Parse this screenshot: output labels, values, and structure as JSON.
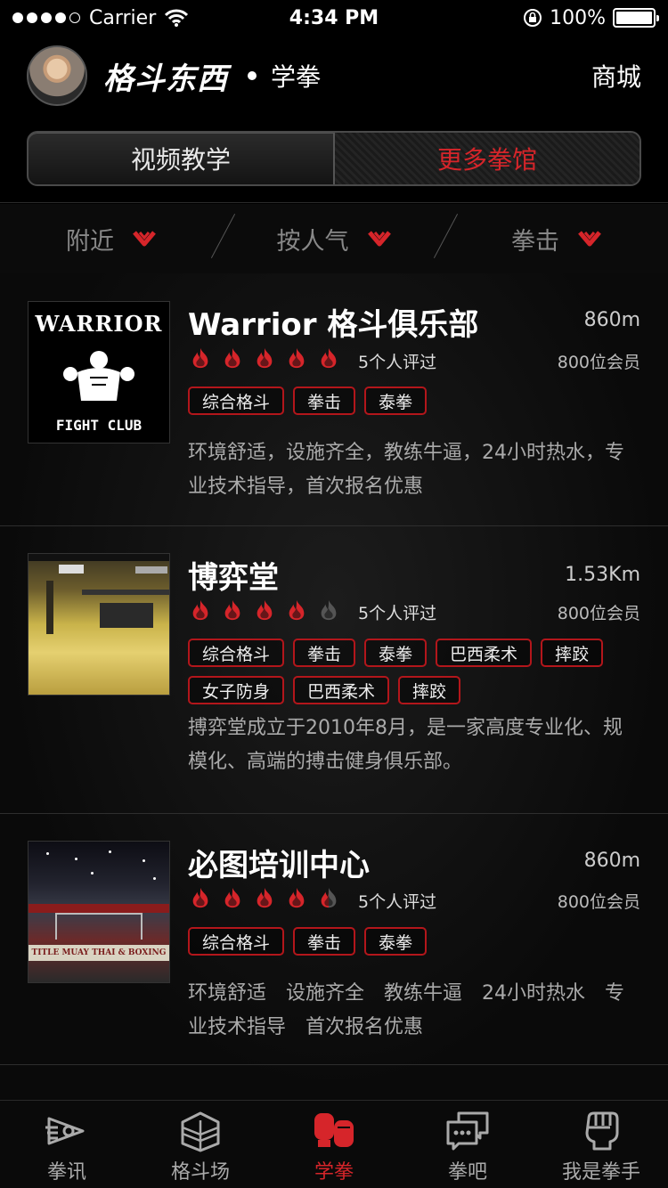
{
  "status": {
    "carrier": "Carrier",
    "time": "4:34 PM",
    "battery": "100%",
    "battery_level": 1.0
  },
  "header": {
    "logo": "格斗东西",
    "section": "学拳",
    "shop": "商城"
  },
  "segments": [
    {
      "label": "视频教学",
      "active": false
    },
    {
      "label": "更多拳馆",
      "active": true
    }
  ],
  "filters": [
    {
      "label": "附近"
    },
    {
      "label": "按人气"
    },
    {
      "label": "拳击"
    }
  ],
  "accent_color": "#d6252a",
  "gyms": [
    {
      "name": "Warrior 格斗俱乐部",
      "image": {
        "title": "WARRIOR",
        "subtitle": "FIGHT CLUB"
      },
      "distance": "860m",
      "rating": 5,
      "reviews": "5个人评过",
      "members": "800位会员",
      "tags": [
        "综合格斗",
        "拳击",
        "泰拳"
      ],
      "desc": "环境舒适，设施齐全，教练牛逼，24小时热水，专业技术指导，首次报名优惠"
    },
    {
      "name": "博弈堂",
      "image": {},
      "distance": "1.53Km",
      "rating": 4,
      "reviews": "5个人评过",
      "members": "800位会员",
      "tags": [
        "综合格斗",
        "拳击",
        "泰拳",
        "巴西柔术",
        "摔跤",
        "女子防身",
        "巴西柔术",
        "摔跤"
      ],
      "desc": "搏弈堂成立于2010年8月，是一家高度专业化、规模化、高端的搏击健身俱乐部。"
    },
    {
      "name": "必图培训中心",
      "image": {
        "banner": "TITLE MUAY THAI & BOXING"
      },
      "distance": "860m",
      "rating": 4.5,
      "reviews": "5个人评过",
      "members": "800位会员",
      "tags": [
        "综合格斗",
        "拳击",
        "泰拳"
      ],
      "desc": "环境舒适　设施齐全　教练牛逼　24小时热水　专业技术指导　首次报名优惠"
    }
  ],
  "tabs": [
    {
      "label": "拳讯",
      "icon": "news-icon",
      "active": false
    },
    {
      "label": "格斗场",
      "icon": "ring-icon",
      "active": false
    },
    {
      "label": "学拳",
      "icon": "gloves-icon",
      "active": true
    },
    {
      "label": "拳吧",
      "icon": "chat-icon",
      "active": false
    },
    {
      "label": "我是拳手",
      "icon": "fist-icon",
      "active": false
    }
  ]
}
